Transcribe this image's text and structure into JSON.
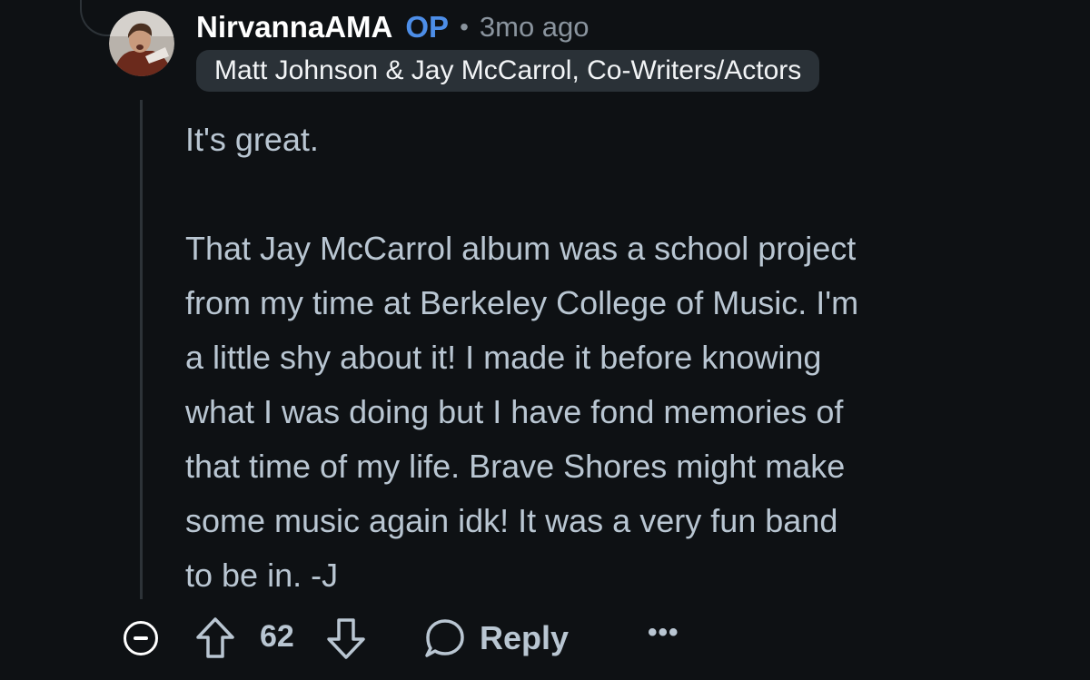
{
  "comment": {
    "author": "NirvannaAMA",
    "op_badge": "OP",
    "separator": "•",
    "timestamp": "3mo ago",
    "flair": "Matt Johnson & Jay McCarrol, Co-Writers/Actors",
    "paragraphs": [
      "It's great.",
      "That Jay McCarrol album was a school project\nfrom my time at Berkeley College of Music. I'm\na little shy about it! I made it before knowing\nwhat I was doing but I have fond memories of\nthat time of my life. Brave Shores might make\nsome music again idk! It was a very fun band\nto be in. -J"
    ]
  },
  "actions": {
    "collapse_icon": "collapse-minus-icon",
    "upvote_icon": "upvote-arrow-icon",
    "vote_count": "62",
    "downvote_icon": "downvote-arrow-icon",
    "reply_icon": "speech-bubble-icon",
    "reply_label": "Reply",
    "more_label": "•••"
  },
  "colors": {
    "background": "#0e1114",
    "body_text": "#b9c6d2",
    "author": "#ffffff",
    "op_badge": "#4d8ee8",
    "meta": "#8a949e",
    "flair_bg": "#2a3137",
    "thread_line": "#2d3338"
  }
}
